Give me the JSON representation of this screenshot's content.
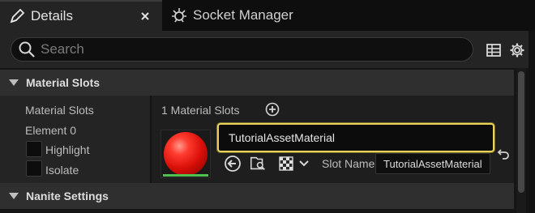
{
  "tabs": [
    {
      "label": "Details",
      "icon": "pencil-icon",
      "active": true
    },
    {
      "label": "Socket Manager",
      "icon": "socket-icon",
      "active": false
    }
  ],
  "search": {
    "placeholder": "Search"
  },
  "toolbar": {
    "table_icon": "table-icon",
    "settings_icon": "gear-icon"
  },
  "categories": {
    "material_slots": "Material Slots",
    "nanite_settings": "Nanite Settings"
  },
  "material_slots": {
    "row_label": "Material Slots",
    "count_text": "1 Material Slots",
    "element_label": "Element 0",
    "highlight_label": "Highlight",
    "isolate_label": "Isolate",
    "material_name": "TutorialAssetMaterial",
    "slot_name_label": "Slot Name",
    "slot_name_value": "TutorialAssetMaterial"
  },
  "colors": {
    "accent_highlight": "#e8d45a",
    "material_red": "#e0140c",
    "thumbnail_bar": "#4fc04f"
  }
}
